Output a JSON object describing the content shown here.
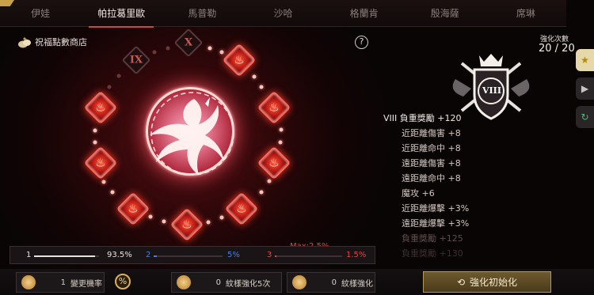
{
  "tabs": [
    "伊娃",
    "帕拉葛里歐",
    "馬普勒",
    "沙哈",
    "格蘭肯",
    "殷海薩",
    "席琳"
  ],
  "active_tab": 1,
  "shop_label": "祝福點數商店",
  "help_label": "?",
  "locked_nodes": [
    "IX",
    "X"
  ],
  "node_icon": "flame-icon",
  "enhance": {
    "label": "強化次數",
    "count": "20 / 20",
    "badge_numeral": "VIII"
  },
  "stats": [
    {
      "text": "VIII 負重獎勵 +120",
      "kind": "main"
    },
    {
      "text": "近距離傷害 +8",
      "kind": "sub"
    },
    {
      "text": "近距離命中 +8",
      "kind": "sub"
    },
    {
      "text": "遠距離傷害 +8",
      "kind": "sub"
    },
    {
      "text": "遠距離命中 +8",
      "kind": "sub"
    },
    {
      "text": "魔攻 +6",
      "kind": "sub"
    },
    {
      "text": "近距離爆擊 +3%",
      "kind": "sub"
    },
    {
      "text": "遠距離爆擊 +3%",
      "kind": "sub"
    },
    {
      "text": "負重獎勵 +125",
      "kind": "fade1"
    },
    {
      "text": "負重獎勵 +130",
      "kind": "fade2"
    }
  ],
  "probability": {
    "s1": {
      "idx": "1",
      "value": "93.5%",
      "fraction": 0.935,
      "color": "#e8e2de"
    },
    "s2": {
      "idx": "2",
      "value": "5%",
      "fraction": 0.05,
      "color": "#4a7fd8"
    },
    "s3": {
      "idx": "3",
      "value": "1.5%",
      "fraction": 0.015,
      "color": "#d84a44"
    },
    "max_label": "Max:2.5%"
  },
  "bottom": {
    "slot1": {
      "qty": "1",
      "label": "變更機率"
    },
    "pct_button": "%",
    "slot2": {
      "qty": "0",
      "label": "紋樣強化5次"
    },
    "slot3": {
      "qty": "0",
      "label": "紋樣強化"
    },
    "reset_label": "強化初始化"
  },
  "colors": {
    "accent": "#d0453e",
    "node": "#b2140f",
    "gold": "#b59a55"
  }
}
